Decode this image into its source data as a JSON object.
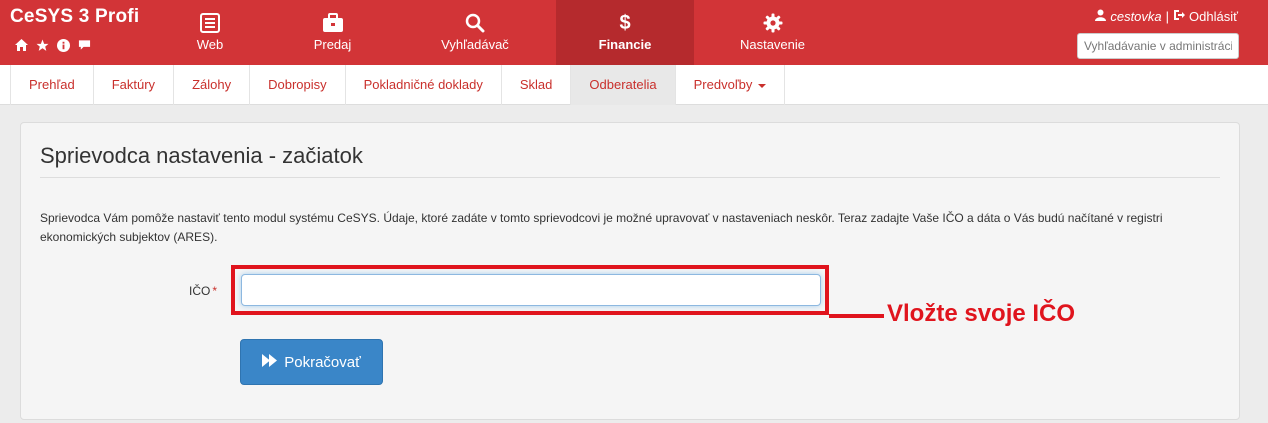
{
  "brand": {
    "title": "CeSYS 3 Profi",
    "icons": [
      "home-icon",
      "star-icon",
      "info-icon",
      "comment-icon"
    ]
  },
  "nav": {
    "items": [
      {
        "label": "Web",
        "icon": "web-icon"
      },
      {
        "label": "Predaj",
        "icon": "briefcase-icon"
      },
      {
        "label": "Vyhľadávač",
        "icon": "search-icon"
      },
      {
        "label": "Financie",
        "icon": "dollar-icon",
        "active": true
      },
      {
        "label": "Nastavenie",
        "icon": "gear-icon"
      }
    ]
  },
  "user": {
    "name": "cestovka",
    "separator": "|",
    "logout_label": "Odhlásiť",
    "search_placeholder": "Vyhľadávanie v administrácii"
  },
  "subnav": {
    "tabs": [
      {
        "label": "Prehľad"
      },
      {
        "label": "Faktúry"
      },
      {
        "label": "Zálohy"
      },
      {
        "label": "Dobropisy"
      },
      {
        "label": "Pokladničné doklady"
      },
      {
        "label": "Sklad"
      },
      {
        "label": "Odberatelia",
        "active": true
      },
      {
        "label": "Predvoľby"
      }
    ]
  },
  "panel": {
    "title": "Sprievodca nastavenia - začiatok",
    "description": "Sprievodca Vám pomôže nastaviť tento modul systému CeSYS. Údaje, ktoré zadáte v tomto sprievodcovi je možné upravovať v nastaveniach neskôr. Teraz zadajte Vaše IČO a dáta o Vás budú načítané v registri ekonomických subjektov (ARES).",
    "ico_label": "IČO",
    "required_mark": "*",
    "ico_value": "",
    "continue_label": "Pokračovať"
  },
  "annotation": {
    "callout": "Vložte svoje IČO",
    "color": "#e0141d"
  },
  "colors": {
    "brand_red": "#d23437",
    "active_red": "#b52a2d",
    "button_blue": "#3a86c8"
  }
}
